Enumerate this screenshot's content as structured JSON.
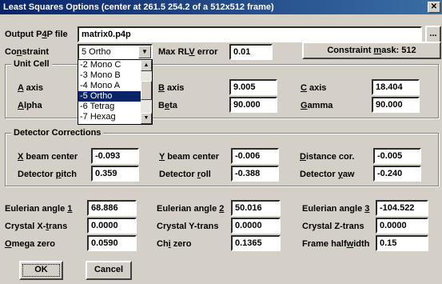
{
  "window": {
    "title": "Least Squares Options (center at 261.5 254.2 of a 512x512 frame)"
  },
  "output": {
    "label_pre": "Output P",
    "label_u": "4",
    "label_post": "P file",
    "value": "matrix0.p4p",
    "browse": "..."
  },
  "constraint": {
    "label_pre": "Co",
    "label_u": "n",
    "label_post": "straint",
    "value": "5 Ortho",
    "options": [
      "-2 Mono C",
      "-3 Mono B",
      "-4 Mono A",
      "-5 Ortho",
      "-6 Tetrag",
      "-7 Hexag"
    ],
    "selected_index": 3
  },
  "rlv": {
    "label_pre": "Max RL",
    "label_u": "V",
    "label_post": " error",
    "value": "0.01"
  },
  "mask": {
    "label_pre": "Constraint ",
    "label_u": "m",
    "label_post": "ask: 512"
  },
  "unit_cell": {
    "title": "Unit Cell",
    "a": {
      "u": "A",
      "rest": " axis",
      "value": ""
    },
    "b": {
      "u": "B",
      "rest": " axis",
      "value": "9.005"
    },
    "c": {
      "u": "C",
      "rest": " axis",
      "value": "18.404"
    },
    "alpha": {
      "u": "A",
      "rest": "lpha",
      "value": ""
    },
    "beta": {
      "pre": "B",
      "u": "e",
      "rest": "ta",
      "value": "90.000"
    },
    "gamma": {
      "u": "G",
      "rest": "amma",
      "value": "90.000"
    }
  },
  "detector": {
    "title": "Detector Corrections",
    "xbeam": {
      "u": "X",
      "rest": " beam center",
      "value": "-0.093"
    },
    "ybeam": {
      "u": "Y",
      "rest": " beam center",
      "value": "-0.006"
    },
    "dist": {
      "u": "D",
      "rest": "istance cor.",
      "value": "-0.005"
    },
    "pitch": {
      "pre": "Detector ",
      "u": "p",
      "rest": "itch",
      "value": "0.359"
    },
    "roll": {
      "pre": "Detector ",
      "u": "r",
      "rest": "oll",
      "value": "-0.388"
    },
    "yaw": {
      "pre": "Detector ",
      "u": "y",
      "rest": "aw",
      "value": "-0.240"
    }
  },
  "euler": {
    "e1": {
      "pre": "Eulerian angle ",
      "u": "1",
      "value": "68.886"
    },
    "e2": {
      "pre": "Eulerian angle ",
      "u": "2",
      "value": "50.016"
    },
    "e3": {
      "pre": "Eulerian angle ",
      "u": "3",
      "value": "-104.522"
    },
    "xt": {
      "pre": "Crystal X-",
      "u": "t",
      "rest": "rans",
      "value": "0.0000"
    },
    "yt": {
      "pre": "Crystal Y-trans",
      "value": "0.0000"
    },
    "zt": {
      "pre": "Crystal Z-trans",
      "value": "0.0000"
    },
    "omega": {
      "u": "O",
      "rest": "mega zero",
      "value": "0.0590"
    },
    "chi": {
      "pre": "Ch",
      "u": "i",
      "rest": " zero",
      "value": "0.1365"
    },
    "half": {
      "pre": "Frame half",
      "u": "w",
      "rest": "idth",
      "value": "0.15"
    }
  },
  "buttons": {
    "ok": "OK",
    "cancel": "Cancel"
  }
}
